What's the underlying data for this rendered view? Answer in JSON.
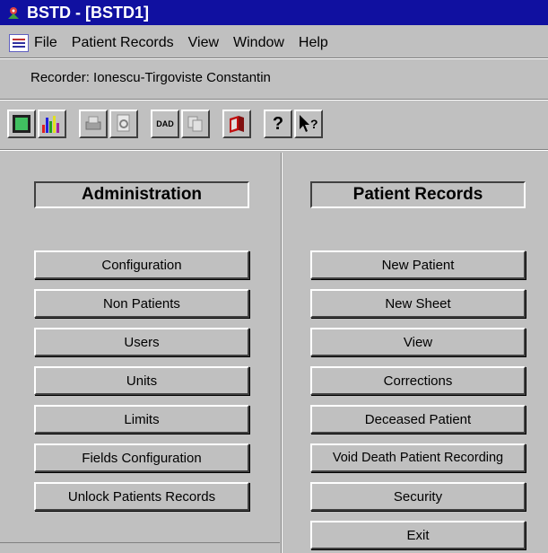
{
  "window": {
    "title": "BSTD - [BSTD1]"
  },
  "menu": {
    "items": [
      "File",
      "Patient Records",
      "View",
      "Window",
      "Help"
    ]
  },
  "recorder": {
    "text": "Recorder: Ionescu-Tirgoviste Constantin"
  },
  "toolbar": {
    "dad_label": "DAD",
    "icons": [
      "form-icon",
      "bar-chart-icon",
      "print-icon",
      "print-preview-icon",
      "dad-icon",
      "copy-icon",
      "book-icon",
      "help-icon",
      "context-help-icon"
    ]
  },
  "admin": {
    "header": "Administration",
    "buttons": [
      "Configuration",
      "Non Patients",
      "Users",
      "Units",
      "Limits",
      "Fields Configuration",
      "Unlock Patients Records"
    ]
  },
  "records": {
    "header": "Patient Records",
    "buttons": [
      "New Patient",
      "New Sheet",
      "View",
      "Corrections",
      "Deceased Patient",
      "Void Death Patient Recording",
      "Security",
      "Exit"
    ]
  }
}
